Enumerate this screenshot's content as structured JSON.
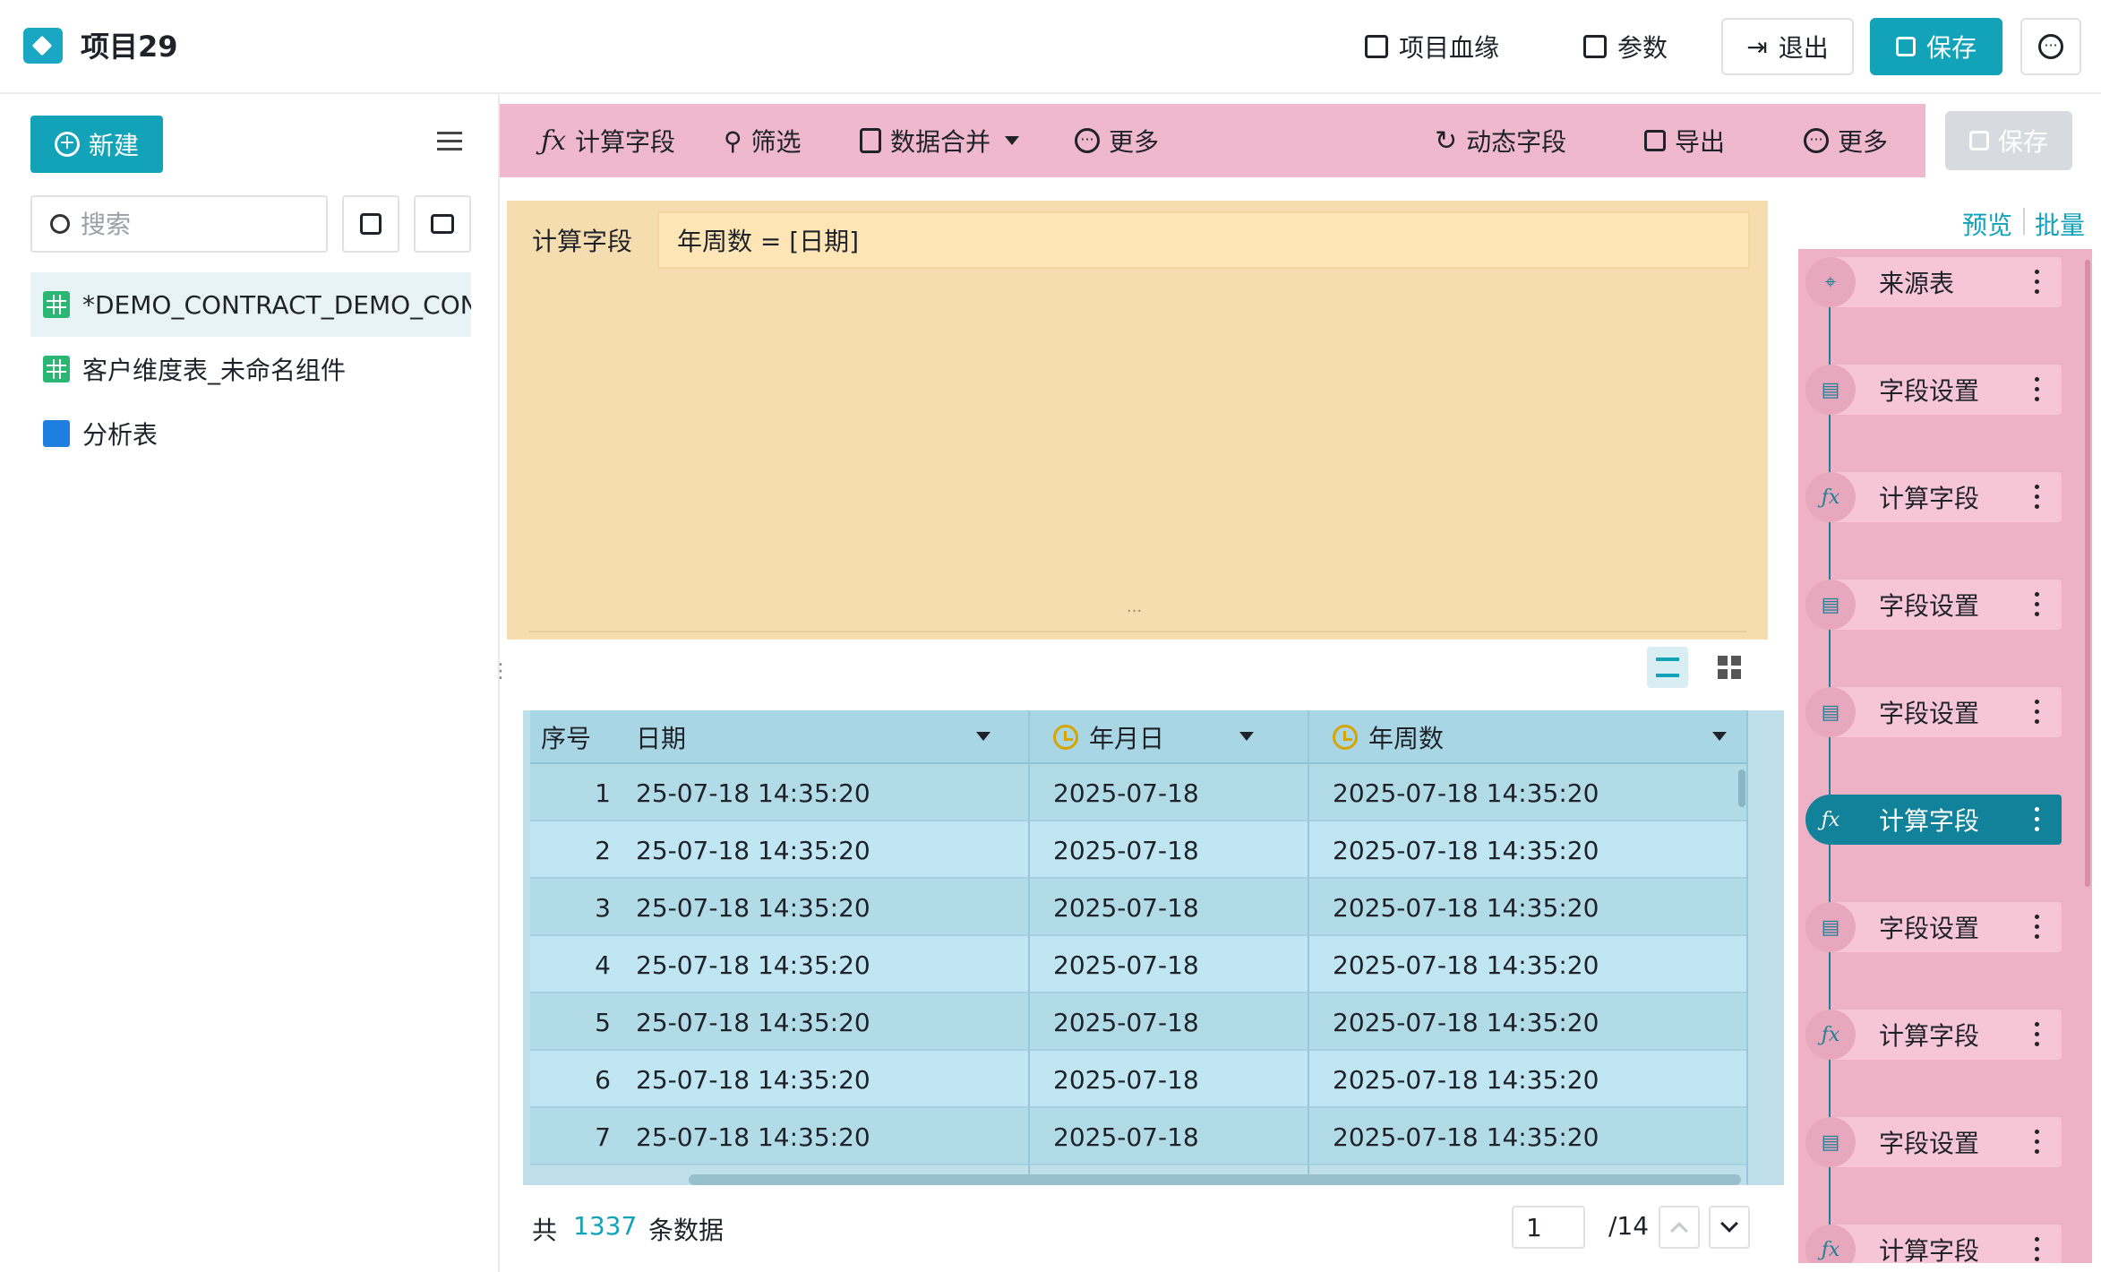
{
  "header": {
    "title": "项目29",
    "lineage_label": "项目血缘",
    "params_label": "参数",
    "exit_label": "退出",
    "save_label": "保存"
  },
  "sidebar": {
    "new_label": "新建",
    "search_placeholder": "搜索",
    "items": [
      {
        "label": "*DEMO_CONTRACT_DEMO_CON",
        "icon": "table-icon"
      },
      {
        "label": "客户维度表_未命名组件",
        "icon": "table-icon"
      },
      {
        "label": "分析表",
        "icon": "chart-icon"
      }
    ]
  },
  "toolbar": {
    "calc_field": "计算字段",
    "filter": "筛选",
    "data_merge": "数据合并",
    "more_left": "更多",
    "dynamic_field": "动态字段",
    "export": "导出",
    "more_right": "更多",
    "save": "保存"
  },
  "editor": {
    "label": "计算字段",
    "formula": "年周数 = [日期]"
  },
  "grid": {
    "headers": {
      "index": "序号",
      "date": "日期",
      "ymd": "年月日",
      "week": "年周数"
    },
    "rows": [
      {
        "i": "1",
        "date": "25-07-18 14:35:20",
        "ymd": "2025-07-18",
        "week": "2025-07-18 14:35:20"
      },
      {
        "i": "2",
        "date": "25-07-18 14:35:20",
        "ymd": "2025-07-18",
        "week": "2025-07-18 14:35:20"
      },
      {
        "i": "3",
        "date": "25-07-18 14:35:20",
        "ymd": "2025-07-18",
        "week": "2025-07-18 14:35:20"
      },
      {
        "i": "4",
        "date": "25-07-18 14:35:20",
        "ymd": "2025-07-18",
        "week": "2025-07-18 14:35:20"
      },
      {
        "i": "5",
        "date": "25-07-18 14:35:20",
        "ymd": "2025-07-18",
        "week": "2025-07-18 14:35:20"
      },
      {
        "i": "6",
        "date": "25-07-18 14:35:20",
        "ymd": "2025-07-18",
        "week": "2025-07-18 14:35:20"
      },
      {
        "i": "7",
        "date": "25-07-18 14:35:20",
        "ymd": "2025-07-18",
        "week": "2025-07-18 14:35:20"
      }
    ]
  },
  "footer": {
    "total_prefix": "共",
    "total_count": "1337",
    "total_suffix": "条数据",
    "page": "1",
    "page_total": "/14"
  },
  "flow": {
    "preview": "预览",
    "batch": "批量",
    "nodes": [
      {
        "label": "来源表",
        "icon": "source-icon"
      },
      {
        "label": "字段设置",
        "icon": "field-settings-icon"
      },
      {
        "label": "计算字段",
        "icon": "fx-icon"
      },
      {
        "label": "字段设置",
        "icon": "field-settings-icon"
      },
      {
        "label": "字段设置",
        "icon": "field-settings-icon"
      },
      {
        "label": "计算字段",
        "icon": "fx-icon",
        "active": true
      },
      {
        "label": "字段设置",
        "icon": "field-settings-icon"
      },
      {
        "label": "计算字段",
        "icon": "fx-icon"
      },
      {
        "label": "字段设置",
        "icon": "field-settings-icon"
      },
      {
        "label": "计算字段",
        "icon": "fx-icon"
      }
    ]
  },
  "colors": {
    "accent": "#12a3b8",
    "toolbar_bg": "#f0b8cc",
    "editor_bg": "#f6ddb0",
    "grid_bg": "#bfe0ea",
    "flow_active": "#12829a"
  }
}
